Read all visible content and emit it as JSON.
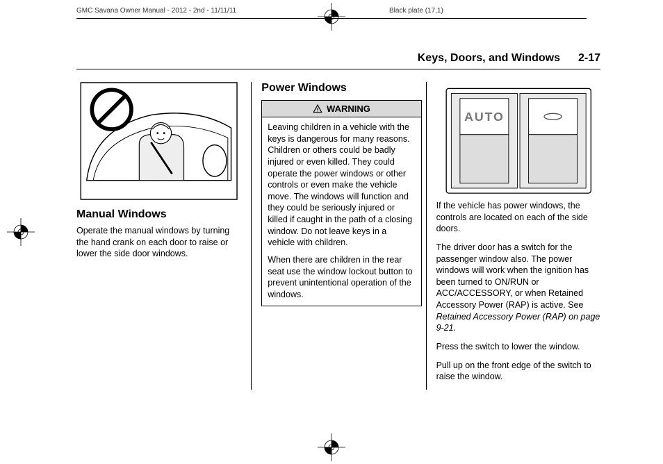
{
  "meta": {
    "doc_info": "GMC Savana Owner Manual - 2012 - 2nd - 11/11/11",
    "plate": "Black plate (17,1)"
  },
  "header": {
    "section": "Keys, Doors, and Windows",
    "page": "2-17"
  },
  "col1": {
    "heading": "Manual Windows",
    "p1": "Operate the manual windows by turning the hand crank on each door to raise or lower the side door windows."
  },
  "col2": {
    "heading": "Power Windows",
    "warning_label": "WARNING",
    "warn_p1": "Leaving children in a vehicle with the keys is dangerous for many reasons. Children or others could be badly injured or even killed. They could operate the power windows or other controls or even make the vehicle move. The windows will function and they could be seriously injured or killed if caught in the path of a closing window. Do not leave keys in a vehicle with children.",
    "warn_p2": "When there are children in the rear seat use the window lockout button to prevent unintentional operation of the windows."
  },
  "col3": {
    "switch_label": "AUTO",
    "p1": "If the vehicle has power windows, the controls are located on each of the side doors.",
    "p2a": "The driver door has a switch for the passenger window also. The power windows will work when the ignition has been turned to ON/RUN or ACC/ACCESSORY, or when Retained Accessory Power (RAP) is active. See ",
    "p2b_ital": "Retained Accessory Power (RAP) on page 9-21",
    "p2c": ".",
    "p3": "Press the switch to lower the window.",
    "p4": "Pull up on the front edge of the switch to raise the window."
  }
}
